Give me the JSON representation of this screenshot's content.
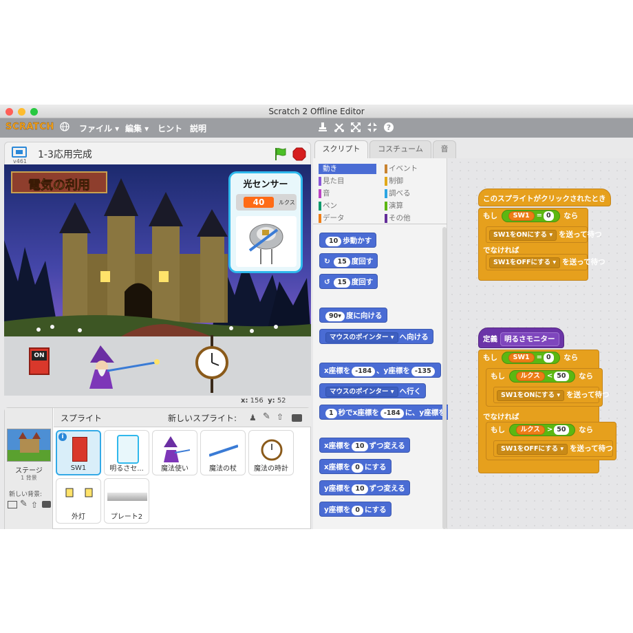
{
  "window": {
    "title": "Scratch 2 Offline Editor",
    "colors": {
      "close": "#ff5f57",
      "minimize": "#febc2e",
      "maximize": "#28c840"
    }
  },
  "menubar": {
    "logo": "SCRATCH",
    "items": [
      "ファイル ▾",
      "編集 ▾",
      "ヒント",
      "説明"
    ],
    "tool_icons": [
      "stamp-icon",
      "scissors-icon",
      "grow-icon",
      "shrink-icon",
      "help-icon"
    ]
  },
  "stage": {
    "project_title": "1-3応用完成",
    "version": "v461",
    "banner": "電気の利用",
    "sensor_monitor": {
      "title": "光センサー",
      "value": "40",
      "unit": "ルクス"
    },
    "coords": {
      "x_label": "x:",
      "x": "156",
      "y_label": "y:",
      "y": "52"
    },
    "switch_label": "ON"
  },
  "sprites": {
    "header": "スプライト",
    "new_sprite": "新しいスプライト:",
    "stage_label": "ステージ",
    "stage_sub": "1 背景",
    "new_backdrop": "新しい背景:",
    "items": [
      {
        "label": "SW1"
      },
      {
        "label": "明るさセ..."
      },
      {
        "label": "魔法使い"
      },
      {
        "label": "魔法の杖"
      },
      {
        "label": "魔法の時計"
      },
      {
        "label": "外灯"
      },
      {
        "label": "プレート2"
      }
    ]
  },
  "tabs": [
    "スクリプト",
    "コスチューム",
    "音"
  ],
  "categories": {
    "left": [
      {
        "label": "動き",
        "color": "#4a6cd4"
      },
      {
        "label": "見た目",
        "color": "#8a55d7"
      },
      {
        "label": "音",
        "color": "#bb42c3"
      },
      {
        "label": "ペン",
        "color": "#0e9a6c"
      },
      {
        "label": "データ",
        "color": "#ee7d16"
      }
    ],
    "right": [
      {
        "label": "イベント",
        "color": "#c88330"
      },
      {
        "label": "制御",
        "color": "#e1a91a"
      },
      {
        "label": "調べる",
        "color": "#2ca5e2"
      },
      {
        "label": "演算",
        "color": "#5cb712"
      },
      {
        "label": "その他",
        "color": "#632d99"
      }
    ]
  },
  "palette_blocks": {
    "move_num": "10",
    "move_text": "歩動かす",
    "turn_r_num": "15",
    "turn_r_text": "度回す",
    "turn_l_num": "15",
    "turn_l_text": "度回す",
    "point_num": "90▾",
    "point_text": "度に向ける",
    "point_towards_dd": "マウスのポインター ▾",
    "point_towards_text": "へ向ける",
    "goto_x_text": "x座標を",
    "goto_x_num": "-184",
    "goto_y_text": "、y座標を",
    "goto_y_num": "-135",
    "goto_dd": "マウスのポインター ▾",
    "goto_text": "へ行く",
    "glide_num": "1",
    "glide_text": "秒でx座標を",
    "glide_x": "-184",
    "glide_text2": "に、y座標を",
    "change_x_text": "x座標を",
    "change_x_num": "10",
    "change_x_text2": "ずつ変える",
    "set_x_text": "x座標を",
    "set_x_num": "0",
    "set_x_text2": "にする",
    "change_y_text": "y座標を",
    "change_y_num": "10",
    "change_y_text2": "ずつ変える",
    "set_y_text": "y座標を",
    "set_y_num": "0",
    "set_y_text2": "にする"
  },
  "script1": {
    "hat": "このスプライトがクリックされたとき",
    "if_kw": "もし",
    "var": "SW1",
    "eq": "=",
    "val": "0",
    "then": "なら",
    "msg1": "SW1をONにする ▾",
    "send": "を送って待つ",
    "else_kw": "でなければ",
    "msg2": "SW1をOFFにする ▾"
  },
  "script2": {
    "define_kw": "定義",
    "proto": "明るさモニター",
    "if_kw": "もし",
    "var": "SW1",
    "eq": "=",
    "val": "0",
    "then": "なら",
    "if2_kw": "もし",
    "var2": "ルクス",
    "lt": "<",
    "val2": "50",
    "then2": "なら",
    "msg1": "SW1をONにする ▾",
    "send": "を送って待つ",
    "else_kw": "でなければ",
    "if3_kw": "もし",
    "var3": "ルクス",
    "gt": ">",
    "val3": "50",
    "then3": "なら",
    "msg2": "SW1をOFFにする ▾"
  }
}
